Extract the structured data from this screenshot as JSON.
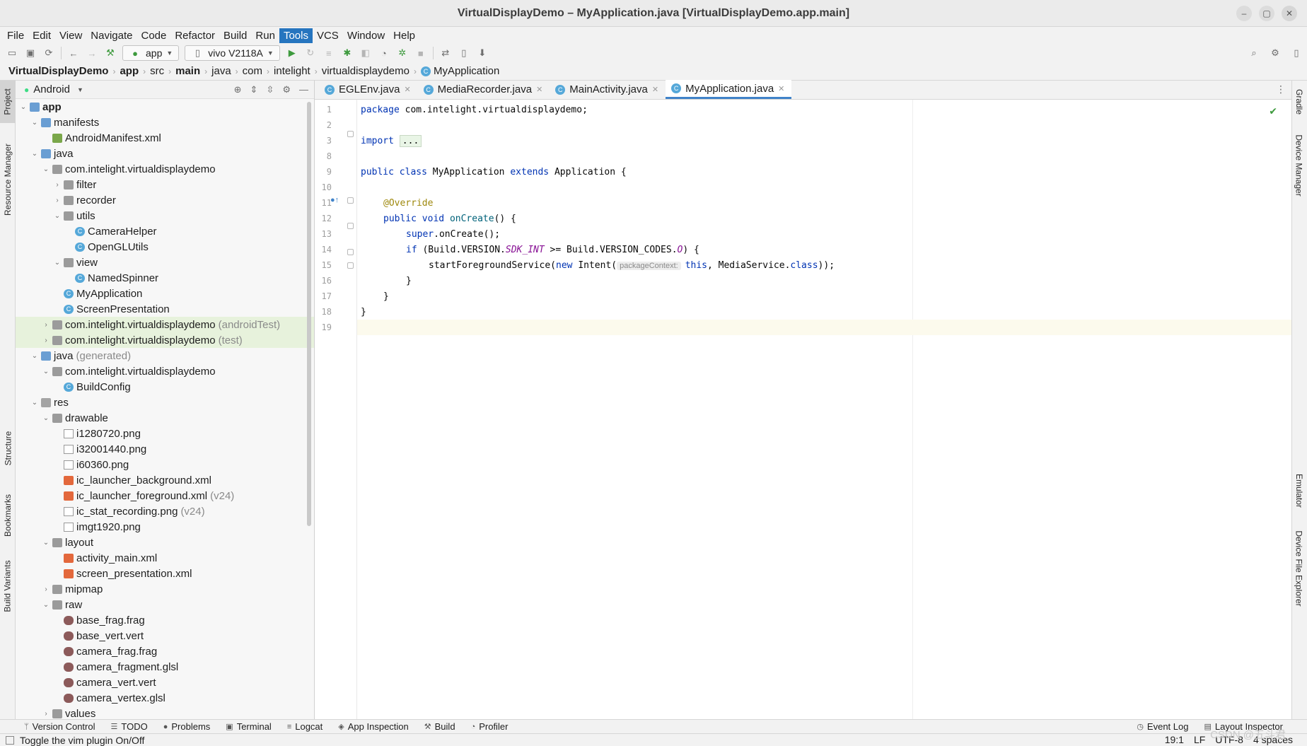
{
  "window": {
    "title": "VirtualDisplayDemo – MyApplication.java [VirtualDisplayDemo.app.main]",
    "controls": [
      "–",
      "▢",
      "✕"
    ]
  },
  "menu": [
    "File",
    "Edit",
    "View",
    "Navigate",
    "Code",
    "Refactor",
    "Build",
    "Run",
    "Tools",
    "VCS",
    "Window",
    "Help"
  ],
  "menu_active": "Tools",
  "toolbar": {
    "config": "app",
    "device": "vivo V2118A"
  },
  "breadcrumb": [
    "VirtualDisplayDemo",
    "app",
    "src",
    "main",
    "java",
    "com",
    "intelight",
    "virtualdisplaydemo",
    "MyApplication"
  ],
  "project_panel": {
    "view": "Android"
  },
  "tree": [
    {
      "label": "app",
      "level": 0,
      "icon": "folder-module",
      "arrow": "down",
      "bold": true
    },
    {
      "label": "manifests",
      "level": 1,
      "icon": "folder",
      "arrow": "down"
    },
    {
      "label": "AndroidManifest.xml",
      "level": 2,
      "icon": "manifest",
      "arrow": ""
    },
    {
      "label": "java",
      "level": 1,
      "icon": "folder",
      "arrow": "down"
    },
    {
      "label": "com.intelight.virtualdisplaydemo",
      "level": 2,
      "icon": "package",
      "arrow": "down"
    },
    {
      "label": "filter",
      "level": 3,
      "icon": "package",
      "arrow": "right"
    },
    {
      "label": "recorder",
      "level": 3,
      "icon": "package",
      "arrow": "right"
    },
    {
      "label": "utils",
      "level": 3,
      "icon": "package",
      "arrow": "down"
    },
    {
      "label": "CameraHelper",
      "level": 4,
      "icon": "class",
      "arrow": ""
    },
    {
      "label": "OpenGLUtils",
      "level": 4,
      "icon": "class",
      "arrow": ""
    },
    {
      "label": "view",
      "level": 3,
      "icon": "package",
      "arrow": "down"
    },
    {
      "label": "NamedSpinner",
      "level": 4,
      "icon": "class",
      "arrow": ""
    },
    {
      "label": "MyApplication",
      "level": 3,
      "icon": "class",
      "arrow": ""
    },
    {
      "label": "ScreenPresentation",
      "level": 3,
      "icon": "class",
      "arrow": ""
    },
    {
      "label": "com.intelight.virtualdisplaydemo",
      "suffix": "(androidTest)",
      "level": 2,
      "icon": "package",
      "arrow": "right",
      "hl": true
    },
    {
      "label": "com.intelight.virtualdisplaydemo",
      "suffix": "(test)",
      "level": 2,
      "icon": "package",
      "arrow": "right",
      "hl": true
    },
    {
      "label": "java",
      "suffix": "(generated)",
      "level": 1,
      "icon": "folder",
      "arrow": "down"
    },
    {
      "label": "com.intelight.virtualdisplaydemo",
      "level": 2,
      "icon": "package",
      "arrow": "down"
    },
    {
      "label": "BuildConfig",
      "level": 3,
      "icon": "class",
      "arrow": ""
    },
    {
      "label": "res",
      "level": 1,
      "icon": "folder-res",
      "arrow": "down"
    },
    {
      "label": "drawable",
      "level": 2,
      "icon": "package",
      "arrow": "down"
    },
    {
      "label": "i1280720.png",
      "level": 3,
      "icon": "png",
      "arrow": ""
    },
    {
      "label": "i32001440.png",
      "level": 3,
      "icon": "png",
      "arrow": ""
    },
    {
      "label": "i60360.png",
      "level": 3,
      "icon": "png",
      "arrow": ""
    },
    {
      "label": "ic_launcher_background.xml",
      "level": 3,
      "icon": "xml",
      "arrow": ""
    },
    {
      "label": "ic_launcher_foreground.xml",
      "suffix": "(v24)",
      "level": 3,
      "icon": "xml",
      "arrow": ""
    },
    {
      "label": "ic_stat_recording.png",
      "suffix": "(v24)",
      "level": 3,
      "icon": "png",
      "arrow": ""
    },
    {
      "label": "imgt1920.png",
      "level": 3,
      "icon": "png",
      "arrow": ""
    },
    {
      "label": "layout",
      "level": 2,
      "icon": "package",
      "arrow": "down"
    },
    {
      "label": "activity_main.xml",
      "level": 3,
      "icon": "xml",
      "arrow": ""
    },
    {
      "label": "screen_presentation.xml",
      "level": 3,
      "icon": "xml",
      "arrow": ""
    },
    {
      "label": "mipmap",
      "level": 2,
      "icon": "package",
      "arrow": "right"
    },
    {
      "label": "raw",
      "level": 2,
      "icon": "package",
      "arrow": "down"
    },
    {
      "label": "base_frag.frag",
      "level": 3,
      "icon": "glsl",
      "arrow": ""
    },
    {
      "label": "base_vert.vert",
      "level": 3,
      "icon": "glsl",
      "arrow": ""
    },
    {
      "label": "camera_frag.frag",
      "level": 3,
      "icon": "glsl",
      "arrow": ""
    },
    {
      "label": "camera_fragment.glsl",
      "level": 3,
      "icon": "glsl",
      "arrow": ""
    },
    {
      "label": "camera_vert.vert",
      "level": 3,
      "icon": "glsl",
      "arrow": ""
    },
    {
      "label": "camera_vertex.glsl",
      "level": 3,
      "icon": "glsl",
      "arrow": ""
    },
    {
      "label": "values",
      "level": 2,
      "icon": "package",
      "arrow": "right"
    }
  ],
  "left_tool_tabs": [
    "Project",
    "Resource Manager",
    "Structure",
    "Bookmarks",
    "Build Variants"
  ],
  "right_tool_tabs": [
    "Gradle",
    "Device Manager",
    "Emulator",
    "Device File Explorer"
  ],
  "editor_tabs": [
    {
      "label": "EGLEnv.java",
      "active": false
    },
    {
      "label": "MediaRecorder.java",
      "active": false
    },
    {
      "label": "MainActivity.java",
      "active": false
    },
    {
      "label": "MyApplication.java",
      "active": true
    }
  ],
  "code": {
    "package_line": {
      "kw": "package",
      "rest": " com.intelight.virtualdisplaydemo;"
    },
    "import_line": {
      "kw": "import",
      "folded": "..."
    },
    "class_line": {
      "kw1": "public",
      "kw2": "class",
      "name": " MyApplication ",
      "kw3": "extends",
      "rest": " Application {"
    },
    "override": "@Override",
    "method_line": {
      "kw1": "public",
      "kw2": "void",
      "fn": "onCreate",
      "rest": "() {"
    },
    "super_line": {
      "kw": "super",
      "rest": ".onCreate();"
    },
    "if_line": {
      "kw": "if",
      "p1": " (Build.VERSION.",
      "c1": "SDK_INT",
      "p2": " >= Build.VERSION_CODES.",
      "c2": "O",
      "p3": ") {"
    },
    "start_line": {
      "p1": "startForegroundService(",
      "kw": "new",
      "p2": " Intent(",
      "hint": "packageContext:",
      "kw2": "this",
      "p3": ", MediaService.",
      "kw3": "class",
      "p4": "));"
    },
    "close_inner": "}",
    "close_method": "}",
    "close_class": "}"
  },
  "line_numbers": [
    "1",
    "2",
    "3",
    "8",
    "9",
    "10",
    "11",
    "12",
    "13",
    "14",
    "15",
    "16",
    "17",
    "18",
    "19"
  ],
  "bottom_tabs": [
    "Version Control",
    "TODO",
    "Problems",
    "Terminal",
    "Logcat",
    "App Inspection",
    "Build",
    "Profiler"
  ],
  "bottom_tabs_right": [
    "Event Log",
    "Layout Inspector"
  ],
  "status": {
    "message": "Toggle the vim plugin On/Off",
    "position": "19:1",
    "line_sep": "LF",
    "encoding": "UTF-8",
    "indent": "4 spaces"
  },
  "watermark": "CSDN @五斗君"
}
